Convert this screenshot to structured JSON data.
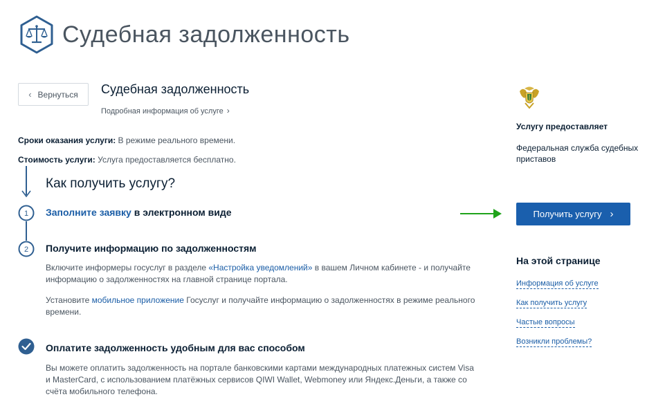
{
  "header": {
    "title": "Судебная задолженность"
  },
  "nav": {
    "back_label": "Вернуться"
  },
  "service": {
    "title": "Судебная задолженность",
    "info_link": "Подробная информация об услуге"
  },
  "terms": {
    "time_label": "Сроки оказания услуги:",
    "time_value": "В режиме реального времени.",
    "cost_label": "Стоимость услуги:",
    "cost_value": "Услуга предоставляется бесплатно."
  },
  "how": {
    "title": "Как получить услугу?",
    "steps": [
      {
        "number": "1",
        "title_link": "Заполните заявку",
        "title_rest": " в электронном виде"
      },
      {
        "number": "2",
        "title": "Получите информацию по задолженностям",
        "p1_pre": "Включите информеры госуслуг в разделе ",
        "p1_link": "«Настройка уведомлений»",
        "p1_post": " в вашем Личном кабинете - и получайте",
        "p1_line2": "информацию о задолженностях на главной странице портала.",
        "p2_pre": "Установите ",
        "p2_link": "мобильное приложение",
        "p2_post": " Госуслуг и получайте информацию о задолженностях в режиме реального",
        "p2_line2": "времени."
      },
      {
        "title": "Оплатите задолженность удобным для вас способом",
        "line1": "Вы можете оплатить задолженность на портале банковскими картами международных платежных систем Visa",
        "line2": "и MasterCard, с использованием платёжных сервисов QIWI Wallet, Webmoney или Яндекс.Деньги, а также со",
        "line3": "счёта мобильного телефона."
      }
    ]
  },
  "sidebar": {
    "provides_label": "Услугу предоставляет",
    "provider_name": "Федеральная служба судебных приставов",
    "get_service_label": "Получить услугу",
    "on_page_title": "На этой странице",
    "links": [
      "Информация об услуге",
      "Как получить услугу",
      "Частые вопросы",
      "Возникли проблемы?"
    ]
  },
  "colors": {
    "primary": "#1a5fad",
    "link": "#1a5da6",
    "arrow": "#1fa31a",
    "logo": "#2f5f91"
  },
  "icons": {
    "logo": "scales-icon",
    "emblem": "fssp-emblem-icon",
    "back": "chevron-left-icon",
    "forward": "chevron-right-icon",
    "check": "check-icon"
  }
}
